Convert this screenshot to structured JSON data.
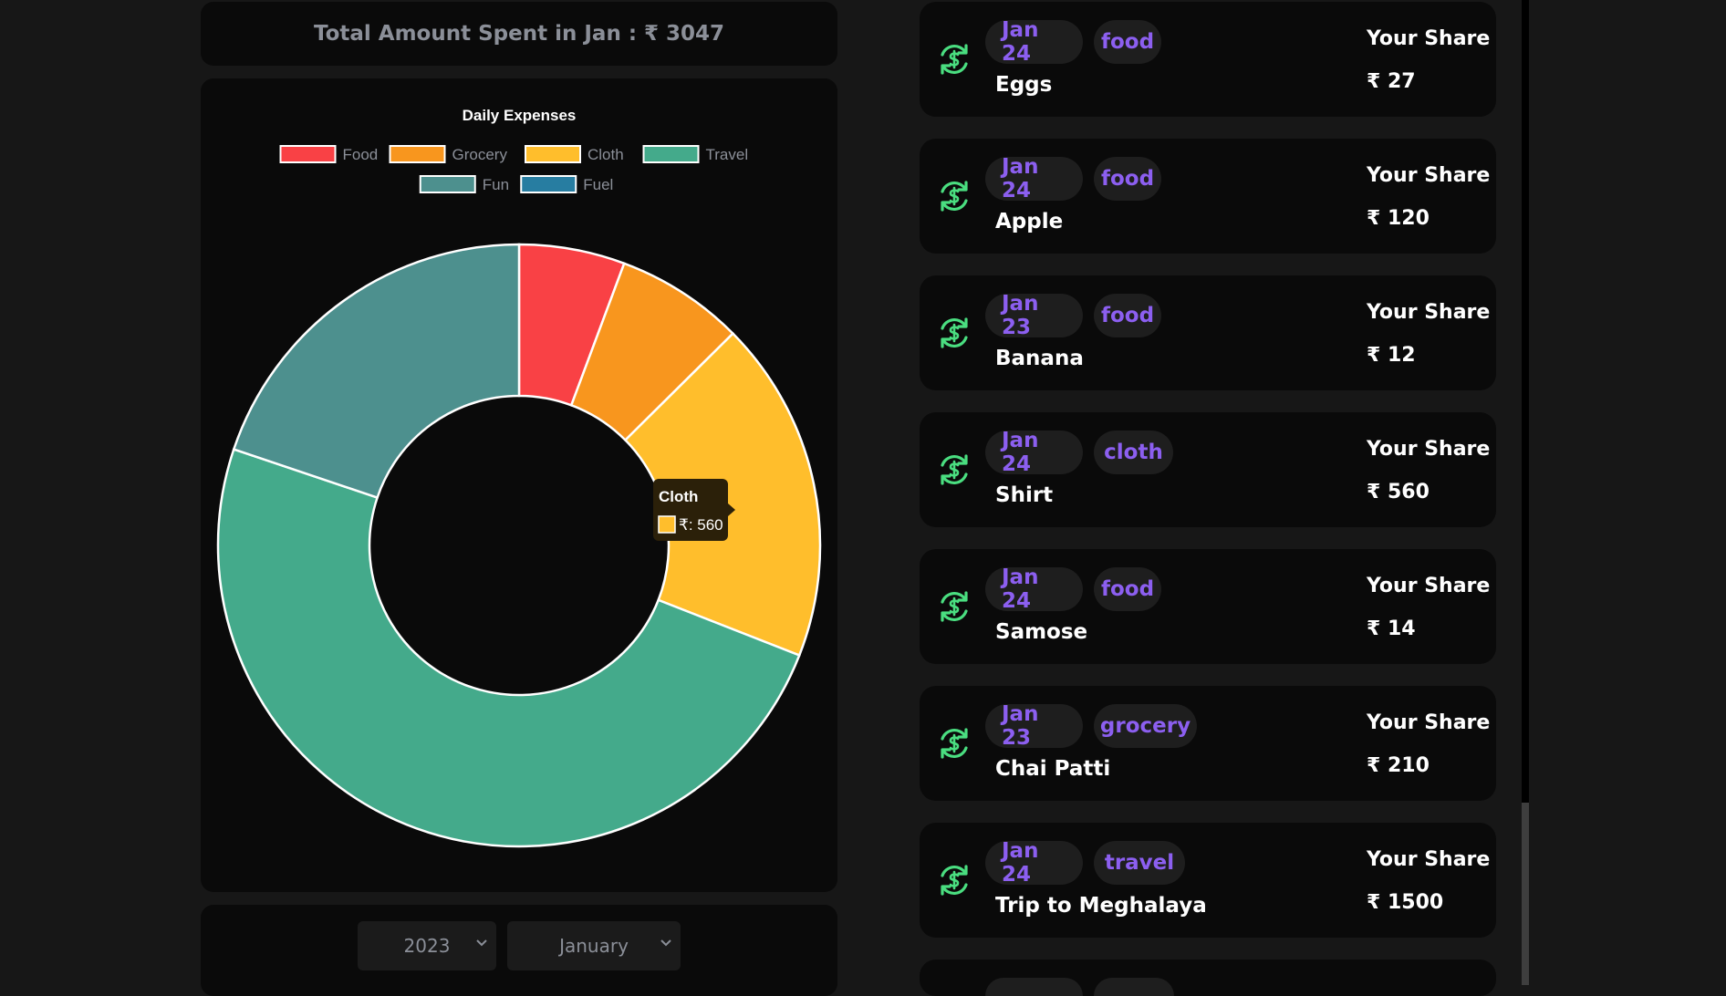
{
  "summary": {
    "total_label": "Total Amount Spent in Jan : ₹ 3047"
  },
  "chart_data": {
    "type": "doughnut",
    "title": "Daily Expenses",
    "categories": [
      "Food",
      "Grocery",
      "Cloth",
      "Travel",
      "Fun",
      "Fuel"
    ],
    "values": [
      173,
      210,
      560,
      1500,
      604,
      0
    ],
    "colors": [
      "#f94145",
      "#f8961e",
      "#ffbe2c",
      "#44aa8b",
      "#4d908e",
      "#277da1"
    ],
    "legend_position": "top",
    "tooltip": {
      "title": "Cloth",
      "label": "₹: 560",
      "color": "#ffbe2c"
    }
  },
  "filters": {
    "year": "2023",
    "month": "January"
  },
  "transactions": [
    {
      "date": "Jan 24",
      "category": "food",
      "title": "Eggs",
      "share_label": "Your Share",
      "amount": "₹ 27"
    },
    {
      "date": "Jan 24",
      "category": "food",
      "title": "Apple",
      "share_label": "Your Share",
      "amount": "₹ 120"
    },
    {
      "date": "Jan 23",
      "category": "food",
      "title": "Banana",
      "share_label": "Your Share",
      "amount": "₹ 12"
    },
    {
      "date": "Jan 24",
      "category": "cloth",
      "title": "Shirt",
      "share_label": "Your Share",
      "amount": "₹ 560"
    },
    {
      "date": "Jan 24",
      "category": "food",
      "title": "Samose",
      "share_label": "Your Share",
      "amount": "₹ 14"
    },
    {
      "date": "Jan 23",
      "category": "grocery",
      "title": "Chai Patti",
      "share_label": "Your Share",
      "amount": "₹ 210"
    },
    {
      "date": "Jan 24",
      "category": "travel",
      "title": "Trip to Meghalaya",
      "share_label": "Your Share",
      "amount": "₹ 1500"
    }
  ],
  "icons": {
    "transaction": "currency-exchange-icon",
    "select_arrow": "chevron-down-icon"
  },
  "colors": {
    "accent_purple": "#8c5ff0",
    "icon_green": "#4ade80",
    "card_bg": "#0a0a0a",
    "page_bg": "#171717"
  }
}
